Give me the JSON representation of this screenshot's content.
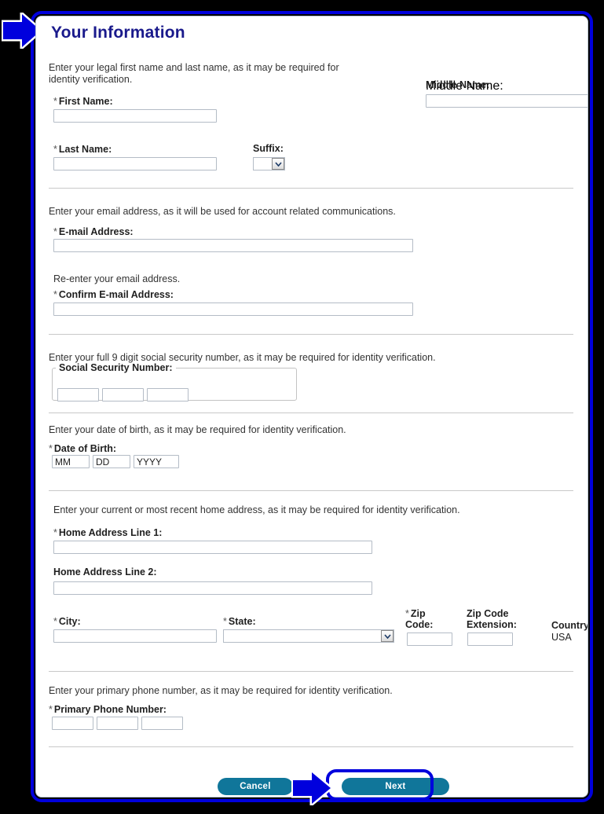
{
  "page": {
    "title": "Your Information",
    "country_label": "Country:",
    "country_value": "USA"
  },
  "sections": {
    "name": {
      "help": "Enter your legal first name and last name, as it may be required for identity verification.",
      "first_name_label": "First Name:",
      "first_name_value": "",
      "middle_name_label": "Middle Name:",
      "middle_name_value": "",
      "last_name_label": "Last Name:",
      "last_name_value": "",
      "suffix_label": "Suffix:",
      "suffix_value": ""
    },
    "email": {
      "help": "Enter your email address, as it will be used for account related communications.",
      "email_label": "E-mail Address:",
      "email_value": "",
      "confirm_help": "Re-enter your email address.",
      "confirm_label": "Confirm E-mail Address:",
      "confirm_value": ""
    },
    "ssn": {
      "help": "Enter your full 9 digit social security number, as it may be required for identity verification.",
      "legend": "Social Security Number:",
      "part1": "",
      "part2": "",
      "part3": ""
    },
    "dob": {
      "help": "Enter your date of birth, as it may be required for identity verification.",
      "label": "Date of Birth:",
      "mm": "MM",
      "dd": "DD",
      "yyyy": "YYYY"
    },
    "address": {
      "help": "Enter your current or most recent home address, as it may be required for identity verification.",
      "line1_label": "Home Address Line 1:",
      "line1_value": "",
      "line2_label": "Home Address Line 2:",
      "line2_value": "",
      "city_label": "City:",
      "city_value": "",
      "state_label": "State:",
      "state_value": "",
      "zip_label": "Zip Code:",
      "zip_value": "",
      "zip_ext_label": "Zip Code Extension:",
      "zip_ext_value": ""
    },
    "phone": {
      "help": "Enter your primary phone number, as it may be required for identity verification.",
      "label": "Primary Phone Number:",
      "part1": "",
      "part2": "",
      "part3": ""
    }
  },
  "footer": {
    "cancel_label": "Cancel",
    "next_label": "Next"
  },
  "markers": {
    "required_marker": "*"
  },
  "colors": {
    "title": "#1a1a8c",
    "button": "#10769a",
    "annotation": "#0000dd",
    "frame": "#000000"
  }
}
